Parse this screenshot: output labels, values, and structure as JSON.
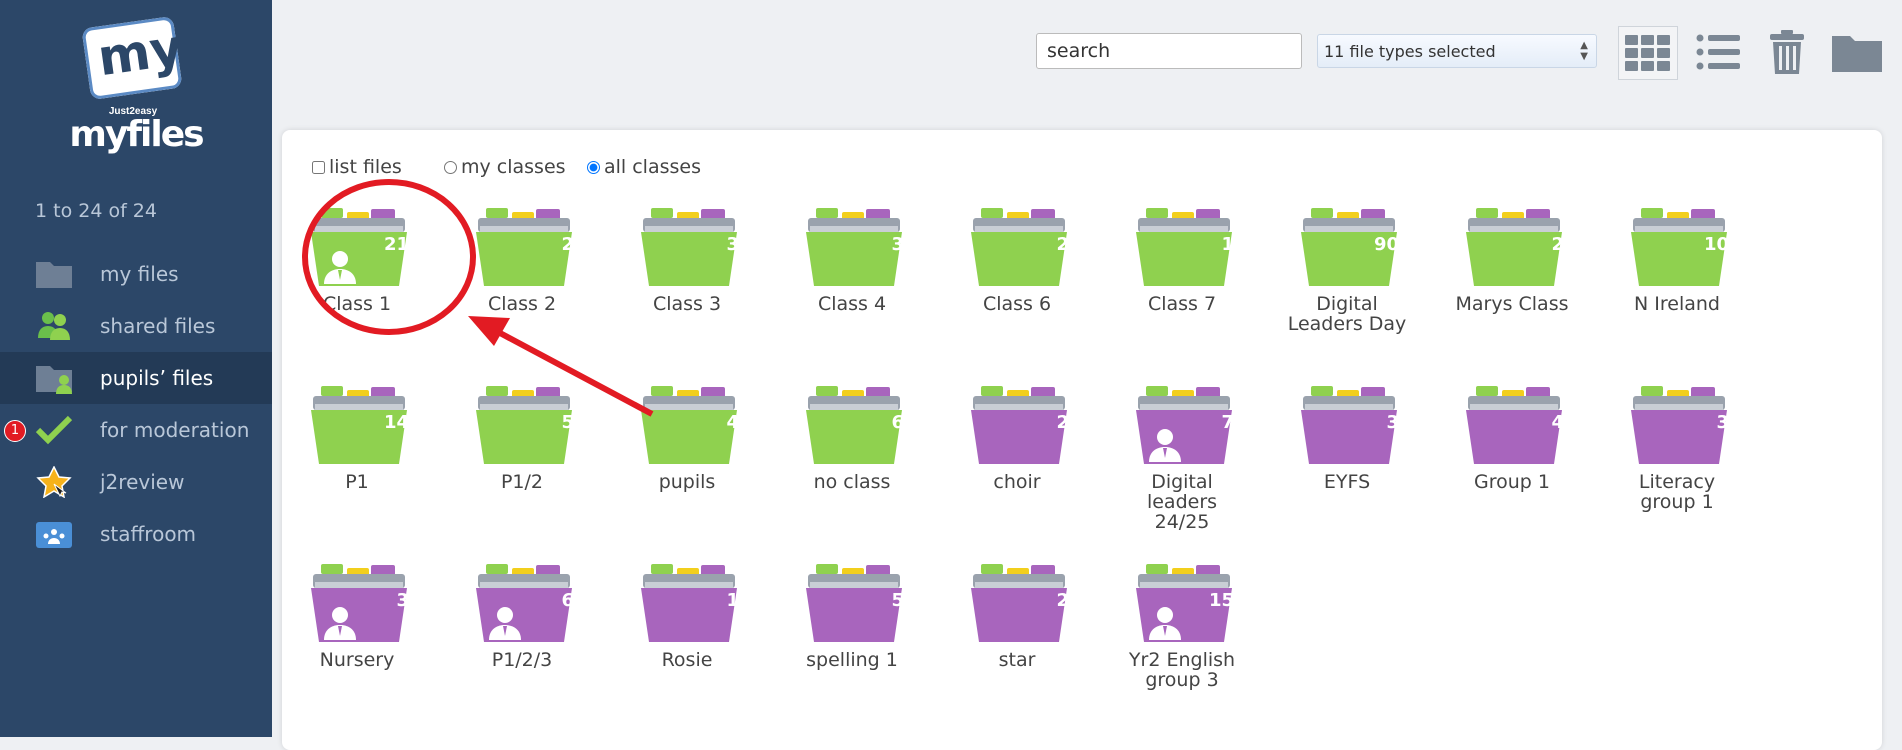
{
  "sidebar": {
    "logo_small": "Just2easy",
    "logo_name": "myfiles",
    "logo_box_text": "my",
    "range_text": "1 to 24 of 24",
    "items": [
      {
        "label": "my files",
        "icon": "folder-icon",
        "active": false
      },
      {
        "label": "shared files",
        "icon": "people-icon",
        "active": false
      },
      {
        "label": "pupils’ files",
        "icon": "pupil-folder-icon",
        "active": true
      },
      {
        "label": "for moderation",
        "icon": "checkmark-icon",
        "active": false,
        "badge": "1"
      },
      {
        "label": "j2review",
        "icon": "star-icon",
        "active": false
      },
      {
        "label": "staffroom",
        "icon": "staffroom-icon",
        "active": false
      }
    ]
  },
  "toolbar": {
    "search_placeholder": "search",
    "file_types_label": "11 file types selected",
    "grid_view_icon": "grid-view-icon",
    "list_view_icon": "list-view-icon",
    "trash_icon": "trash-icon",
    "folder_icon": "new-folder-icon"
  },
  "options": {
    "list_files": "list files",
    "list_files_checked": false,
    "my_classes": "my classes",
    "all_classes": "all classes",
    "selected": "all classes"
  },
  "colors": {
    "sidebar_bg": "#2c4768",
    "green_folder": "#8fd14f",
    "purple_folder": "#a865bd",
    "annotation_red": "#e21b23"
  },
  "folders": [
    {
      "name": "Class 1",
      "count": "21",
      "color": "green",
      "person": true
    },
    {
      "name": "Class 2",
      "count": "2",
      "color": "green",
      "person": false
    },
    {
      "name": "Class 3",
      "count": "3",
      "color": "green",
      "person": false
    },
    {
      "name": "Class 4",
      "count": "3",
      "color": "green",
      "person": false
    },
    {
      "name": "Class 6",
      "count": "2",
      "color": "green",
      "person": false
    },
    {
      "name": "Class 7",
      "count": "1",
      "color": "green",
      "person": false
    },
    {
      "name": "Digital Leaders Day",
      "count": "90",
      "color": "green",
      "person": false
    },
    {
      "name": "Marys Class",
      "count": "2",
      "color": "green",
      "person": false
    },
    {
      "name": "N Ireland",
      "count": "10",
      "color": "green",
      "person": false
    },
    {
      "name": "P1",
      "count": "14",
      "color": "green",
      "person": false
    },
    {
      "name": "P1/2",
      "count": "5",
      "color": "green",
      "person": false
    },
    {
      "name": "pupils",
      "count": "4",
      "color": "green",
      "person": false
    },
    {
      "name": "no class",
      "count": "6",
      "color": "green",
      "person": false
    },
    {
      "name": "choir",
      "count": "2",
      "color": "purple",
      "person": false
    },
    {
      "name": "Digital leaders 24/25",
      "count": "7",
      "color": "purple",
      "person": true
    },
    {
      "name": "EYFS",
      "count": "3",
      "color": "purple",
      "person": false
    },
    {
      "name": "Group 1",
      "count": "4",
      "color": "purple",
      "person": false
    },
    {
      "name": "Literacy group 1",
      "count": "3",
      "color": "purple",
      "person": false
    },
    {
      "name": "Nursery",
      "count": "3",
      "color": "purple",
      "person": true
    },
    {
      "name": "P1/2/3",
      "count": "6",
      "color": "purple",
      "person": true
    },
    {
      "name": "Rosie",
      "count": "1",
      "color": "purple",
      "person": false
    },
    {
      "name": "spelling 1",
      "count": "5",
      "color": "purple",
      "person": false
    },
    {
      "name": "star",
      "count": "2",
      "color": "purple",
      "person": false
    },
    {
      "name": "Yr2 English group 3",
      "count": "15",
      "color": "purple",
      "person": true
    }
  ]
}
